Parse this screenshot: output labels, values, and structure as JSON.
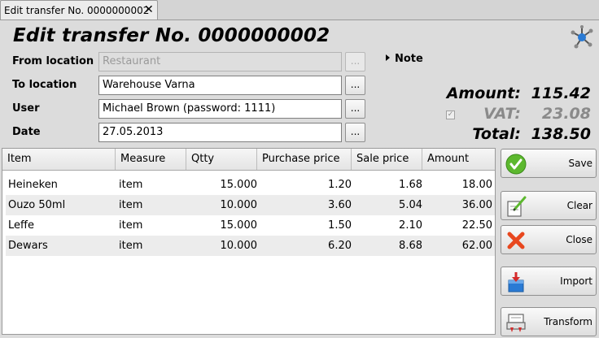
{
  "tab": {
    "title": "Edit transfer No. 0000000002",
    "close": "✕"
  },
  "heading": {
    "title": "Edit transfer No. 0000000002"
  },
  "fields": {
    "from_location": {
      "label": "From location",
      "value": "Restaurant"
    },
    "to_location": {
      "label": "To location",
      "value": "Warehouse Varna"
    },
    "user": {
      "label": "User",
      "value": "Michael Brown (password: 1111)"
    },
    "date": {
      "label": "Date",
      "value": "27.05.2013"
    },
    "picker_label": "..."
  },
  "note": {
    "label": "Note"
  },
  "totals": {
    "amount_label": "Amount:",
    "amount": "115.42",
    "vat_label": "VAT:",
    "vat": "23.08",
    "vat_checked": true,
    "total_label": "Total:",
    "total": "138.50"
  },
  "grid": {
    "columns": [
      "Item",
      "Measure",
      "Qtty",
      "Purchase price",
      "Sale price",
      "Amount"
    ],
    "rows": [
      [
        "Heineken",
        "item",
        "15.000",
        "1.20",
        "1.68",
        "18.00"
      ],
      [
        "Ouzo 50ml",
        "item",
        "10.000",
        "3.60",
        "5.04",
        "36.00"
      ],
      [
        "Leffe",
        "item",
        "15.000",
        "1.50",
        "2.10",
        "22.50"
      ],
      [
        "Dewars",
        "item",
        "10.000",
        "6.20",
        "8.68",
        "62.00"
      ]
    ]
  },
  "buttons": {
    "save": "Save",
    "clear": "Clear",
    "close": "Close",
    "import": "Import",
    "transform": "Transform"
  },
  "colors": {
    "save_icon": "#5cb82e",
    "close_icon": "#e8471e",
    "accent": "#2a7ad4"
  }
}
